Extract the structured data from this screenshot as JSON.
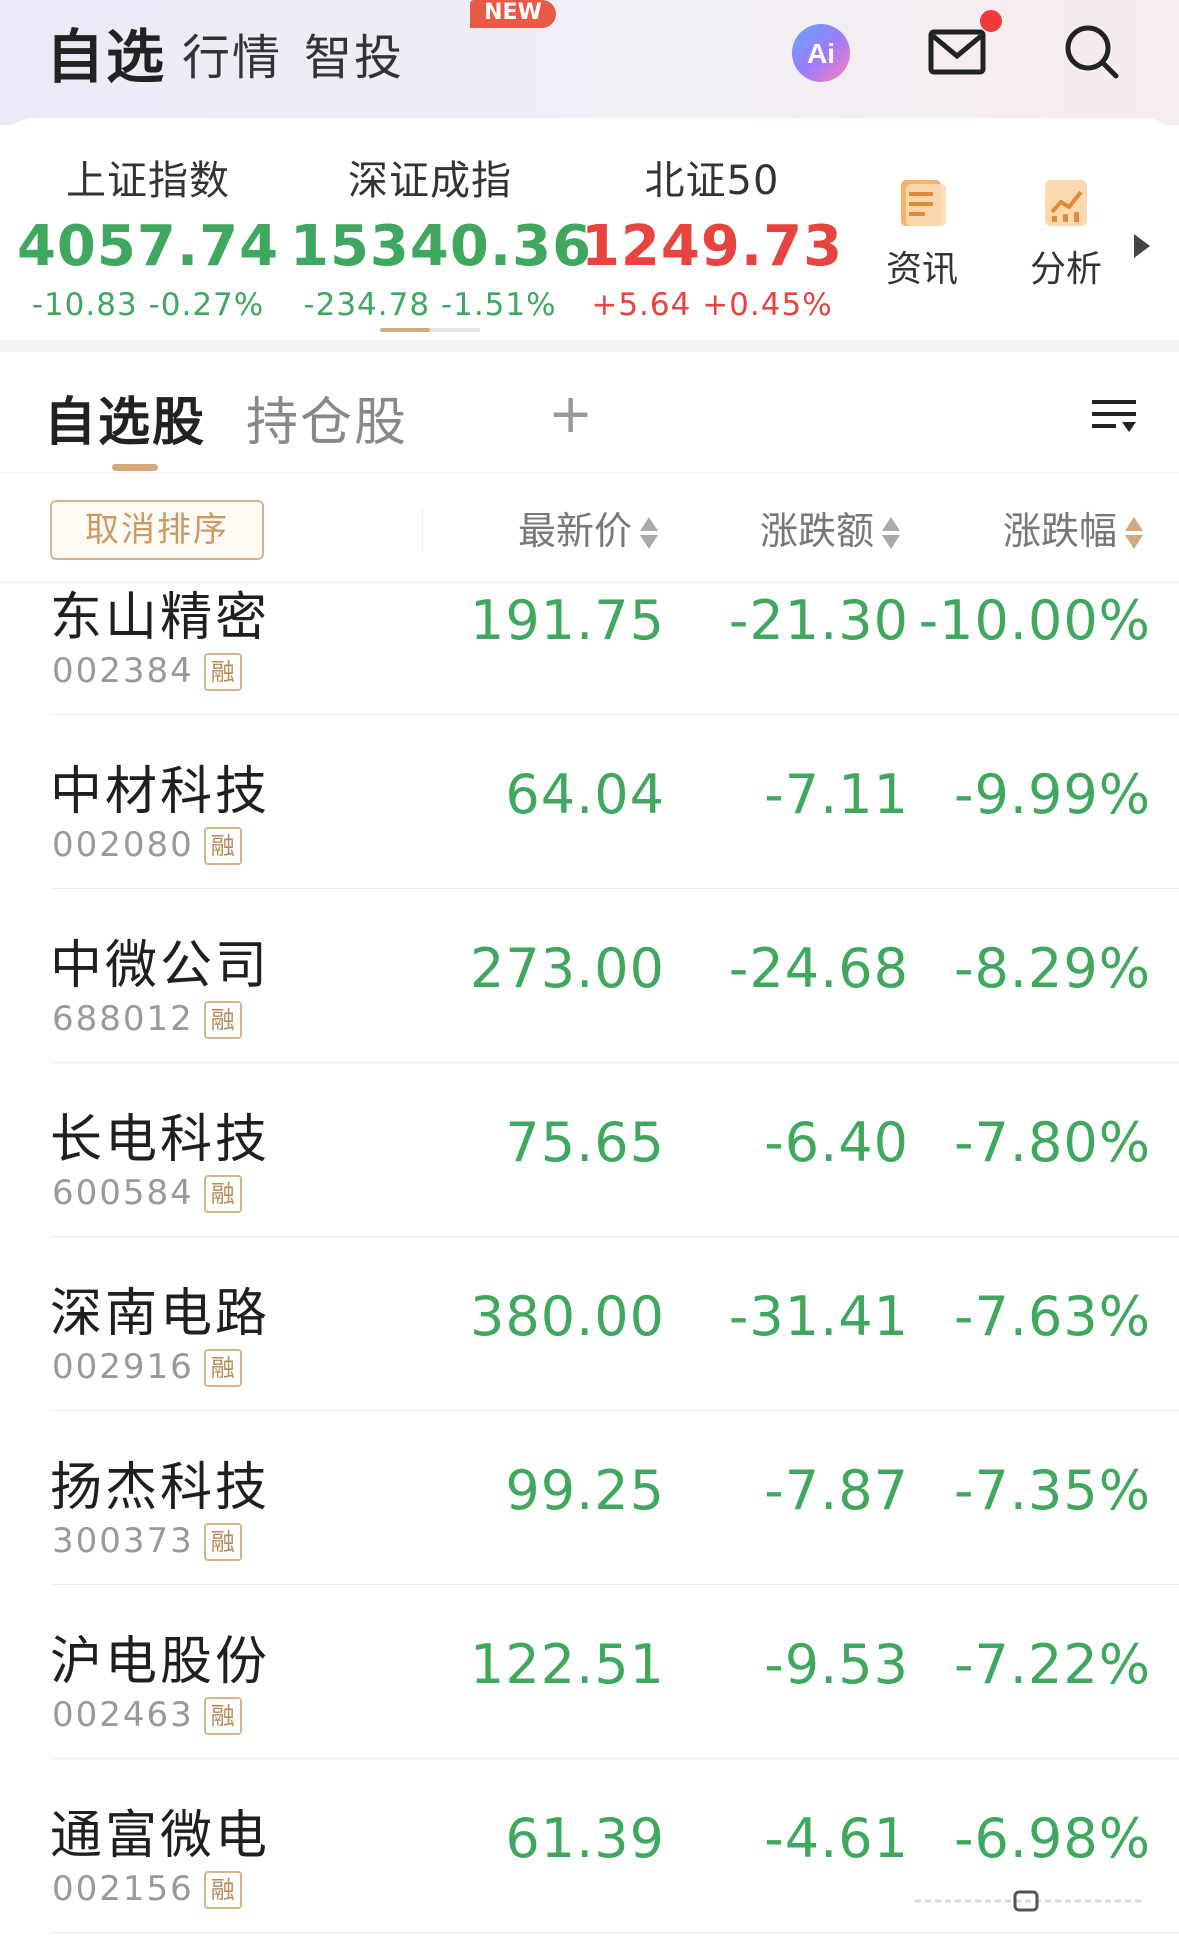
{
  "nav": {
    "tabs": [
      "自选",
      "行情",
      "智投"
    ],
    "new_badge": "NEW",
    "ai_label": "Ai",
    "icons": [
      "ai-assistant-icon",
      "mail-icon",
      "search-icon"
    ]
  },
  "indices": [
    {
      "name": "上证指数",
      "value": "4057.74",
      "change": "-10.83 -0.27%",
      "trend": "down"
    },
    {
      "name": "深证成指",
      "value": "15340.36",
      "change": "-234.78 -1.51%",
      "trend": "down"
    },
    {
      "name": "北证50",
      "value": "1249.73",
      "change": "+5.64 +0.45%",
      "trend": "up"
    }
  ],
  "tools": [
    {
      "label": "资讯",
      "icon": "news-icon"
    },
    {
      "label": "分析",
      "icon": "analysis-chart-icon"
    }
  ],
  "list_tabs": {
    "items": [
      "自选股",
      "持仓股"
    ],
    "add": "+"
  },
  "table": {
    "cancel_sort": "取消排序",
    "columns": [
      "最新价",
      "涨跌额",
      "涨跌幅"
    ],
    "rows": [
      {
        "name": "东山精密",
        "code": "002384",
        "tag": "融",
        "price": "191.75",
        "change": "-21.30",
        "pct": "-10.00%"
      },
      {
        "name": "中材科技",
        "code": "002080",
        "tag": "融",
        "price": "64.04",
        "change": "-7.11",
        "pct": "-9.99%"
      },
      {
        "name": "中微公司",
        "code": "688012",
        "tag": "融",
        "price": "273.00",
        "change": "-24.68",
        "pct": "-8.29%"
      },
      {
        "name": "长电科技",
        "code": "600584",
        "tag": "融",
        "price": "75.65",
        "change": "-6.40",
        "pct": "-7.80%"
      },
      {
        "name": "深南电路",
        "code": "002916",
        "tag": "融",
        "price": "380.00",
        "change": "-31.41",
        "pct": "-7.63%"
      },
      {
        "name": "扬杰科技",
        "code": "300373",
        "tag": "融",
        "price": "99.25",
        "change": "-7.87",
        "pct": "-7.35%"
      },
      {
        "name": "沪电股份",
        "code": "002463",
        "tag": "融",
        "price": "122.51",
        "change": "-9.53",
        "pct": "-7.22%"
      },
      {
        "name": "通富微电",
        "code": "002156",
        "tag": "融",
        "price": "61.39",
        "change": "-4.61",
        "pct": "-6.98%"
      }
    ]
  },
  "colors": {
    "down": "#3fa75e",
    "up": "#e8443f",
    "accent": "#d4a97a"
  }
}
